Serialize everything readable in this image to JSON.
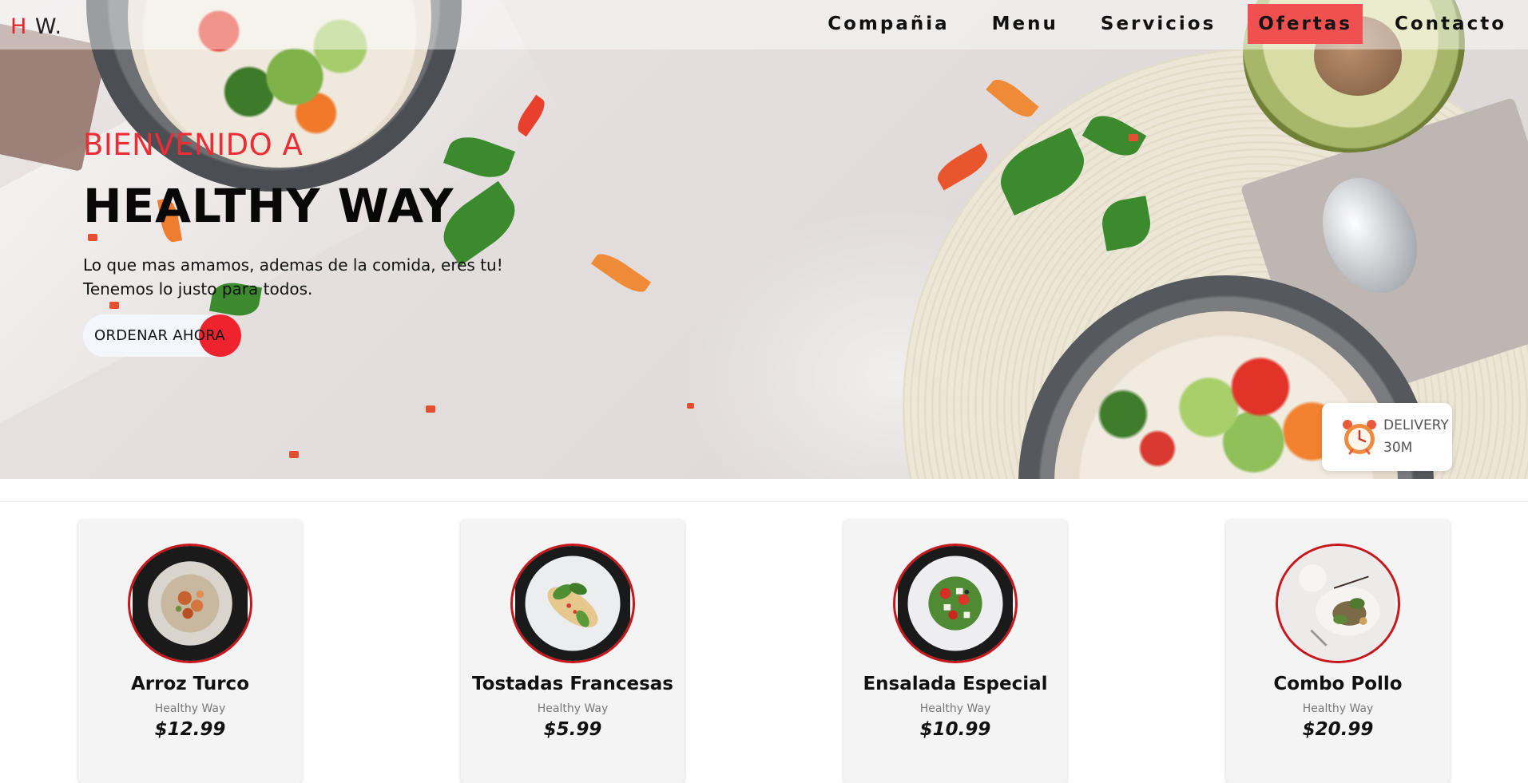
{
  "navbar": {
    "logo": {
      "letter_accent": "H",
      "rest": " W."
    },
    "links": [
      {
        "label": "Compañia",
        "active": false
      },
      {
        "label": "Menu",
        "active": false
      },
      {
        "label": "Servicios",
        "active": false
      },
      {
        "label": "Ofertas",
        "active": true
      },
      {
        "label": "Contacto",
        "active": false
      }
    ]
  },
  "hero": {
    "welcome": "BIENVENIDO A",
    "title": "HEALTHY WAY",
    "tagline_line1": "Lo que mas amamos, ademas de la comida, eres tu!",
    "tagline_line2": "Tenemos lo justo para todos.",
    "cta_label": "ORDENAR AHORA"
  },
  "delivery": {
    "icon": "alarm-clock-icon",
    "label": "DELIVERY",
    "time": "30M"
  },
  "menu_cards": [
    {
      "name": "Arroz Turco",
      "brand": "Healthy Way",
      "price": "$12.99",
      "image": "turkish-rice-plate"
    },
    {
      "name": "Tostadas Francesas",
      "brand": "Healthy Way",
      "price": "$5.99",
      "image": "french-toast-plate"
    },
    {
      "name": "Ensalada Especial",
      "brand": "Healthy Way",
      "price": "$10.99",
      "image": "special-salad-plate"
    },
    {
      "name": "Combo Pollo",
      "brand": "Healthy Way",
      "price": "$20.99",
      "image": "chicken-combo-plate"
    }
  ],
  "colors": {
    "accent": "#e62229",
    "active_nav_bg": "#f05150",
    "card_bg": "#f4f4f4"
  }
}
